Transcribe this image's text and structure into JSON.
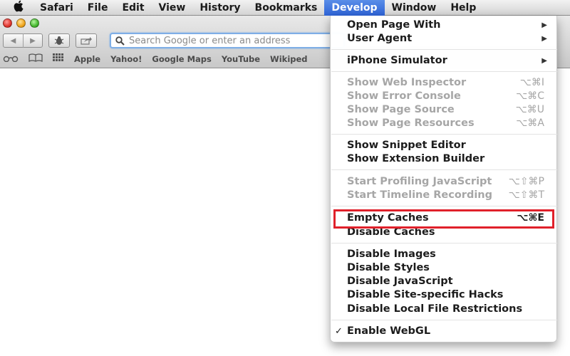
{
  "menubar": {
    "apple_icon": "apple-logo-icon",
    "items": [
      "Safari",
      "File",
      "Edit",
      "View",
      "History",
      "Bookmarks",
      "Develop",
      "Window",
      "Help"
    ],
    "active": "Develop"
  },
  "toolbar": {
    "back_icon": "◀",
    "forward_icon": "▶",
    "bug_icon": "🐞",
    "share_icon": "↗",
    "address_placeholder": "Search Google or enter an address",
    "search_icon": "⚲"
  },
  "bookmarks_bar": {
    "reading_list_icon": "oo",
    "bookmarks_icon": "📖",
    "top_sites_icon": "▦",
    "items": [
      "Apple",
      "Yahoo!",
      "Google Maps",
      "YouTube",
      "Wikiped"
    ]
  },
  "develop_menu": {
    "open_page_with": "Open Page With",
    "user_agent": "User Agent",
    "iphone_simulator": "iPhone Simulator",
    "show_web_inspector": {
      "label": "Show Web Inspector",
      "shortcut": "⌥⌘I"
    },
    "show_error_console": {
      "label": "Show Error Console",
      "shortcut": "⌥⌘C"
    },
    "show_page_source": {
      "label": "Show Page Source",
      "shortcut": "⌥⌘U"
    },
    "show_page_resources": {
      "label": "Show Page Resources",
      "shortcut": "⌥⌘A"
    },
    "show_snippet_editor": "Show Snippet Editor",
    "show_extension_builder": "Show Extension Builder",
    "start_profiling_js": {
      "label": "Start Profiling JavaScript",
      "shortcut": "⌥⇧⌘P"
    },
    "start_timeline_recording": {
      "label": "Start Timeline Recording",
      "shortcut": "⌥⇧⌘T"
    },
    "empty_caches": {
      "label": "Empty Caches",
      "shortcut": "⌥⌘E"
    },
    "disable_caches": "Disable Caches",
    "disable_images": "Disable Images",
    "disable_styles": "Disable Styles",
    "disable_javascript": "Disable JavaScript",
    "disable_site_hacks": "Disable Site-specific Hacks",
    "disable_local_file_restrictions": "Disable Local File Restrictions",
    "enable_webgl": {
      "label": "Enable WebGL",
      "checked": "✓"
    },
    "submenu_arrow": "▶"
  },
  "highlight_color": "#e0202a"
}
